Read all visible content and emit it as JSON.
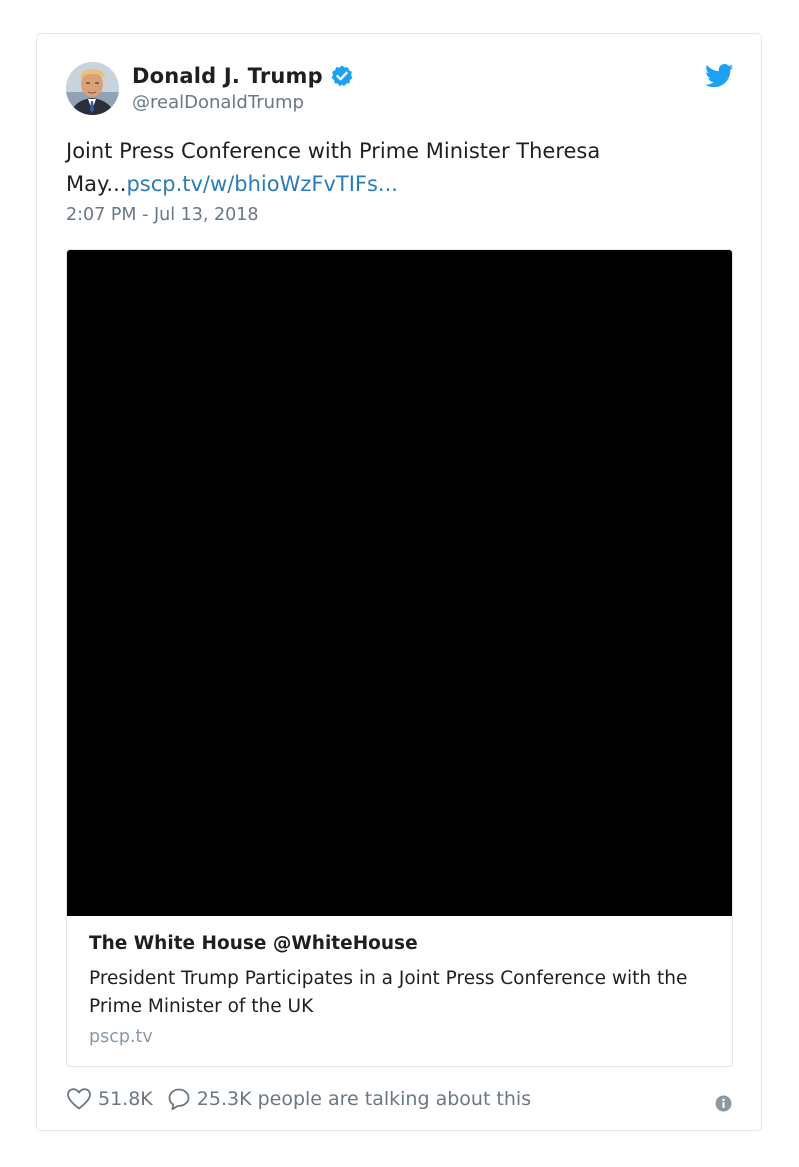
{
  "tweet": {
    "author_name": "Donald J. Trump",
    "author_handle": "@realDonaldTrump",
    "text": "Joint Press Conference with Prime Minister Theresa May...",
    "link_text": "pscp.tv/w/bhioWzFvTIFs...",
    "timestamp": "2:07 PM - Jul 13, 2018"
  },
  "media_card": {
    "author": "The White House @WhiteHouse",
    "title": "President Trump Participates in a Joint Press Conference with the Prime Minister of the UK",
    "domain": "pscp.tv"
  },
  "footer": {
    "likes": "51.8K",
    "conversation_text": "25.3K people are talking about this"
  },
  "icons": {
    "verified": "verified-badge-icon",
    "brand": "twitter-bird-icon",
    "like": "heart-icon",
    "reply": "speech-bubble-icon",
    "info": "info-icon"
  },
  "colors": {
    "link": "#2b7bb9",
    "verified": "#1da1f2",
    "brand": "#1da1f2",
    "secondary_text": "#697882",
    "video_background": "#000000"
  }
}
